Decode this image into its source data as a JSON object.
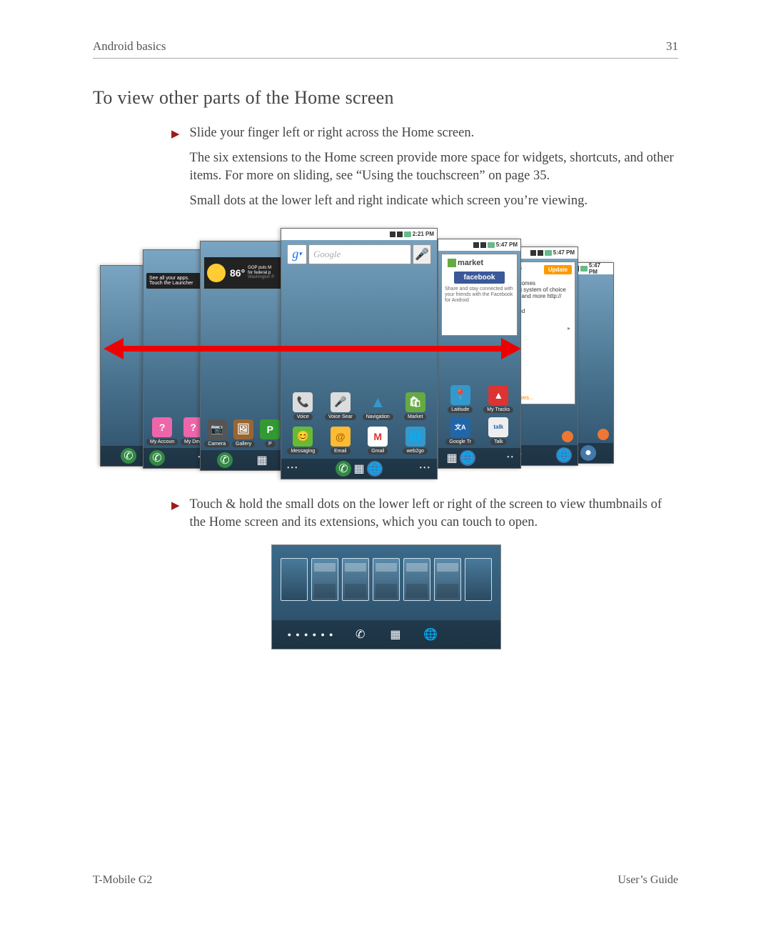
{
  "header": {
    "section": "Android basics",
    "page_number": "31"
  },
  "title": "To view other parts of the Home screen",
  "bullets": [
    {
      "lead": "Slide your finger left or right across the Home screen.",
      "paras": [
        "The six extensions to the Home screen provide more space for widgets, shortcuts, and other items. For more on sliding, see “Using the touchscreen” on page 35.",
        "Small dots at the lower left and right indicate which screen you’re viewing."
      ]
    },
    {
      "lead": "Touch & hold the small dots on the lower left or right of the screen to view thumbnails of the Home screen and its extensions, which you can touch to open.",
      "paras": []
    }
  ],
  "footer": {
    "left": "T-Mobile G2",
    "right": "User’s Guide"
  },
  "fig_large": {
    "status_times": {
      "center": "2:21 PM",
      "side": "5:47 PM"
    },
    "tip_text": "See all your apps. Touch the Launcher",
    "news": {
      "temp": "86°",
      "headline": "GOP puts M",
      "sub1": "for federal p",
      "sub2": "Washington P"
    },
    "search_placeholder": "Google",
    "market": {
      "title": "market",
      "fb": "facebook",
      "desc": "Share and stay connected with your friends with the Facebook for Android"
    },
    "update": {
      "btn": "Update",
      "line1": "g?",
      "line2": "ecomes",
      "line3": "ng system of choice",
      "line4": "ai and more http://",
      "line5": "eed",
      "bottom": "tuses..."
    },
    "apps_center_row1": [
      {
        "label": "Voice",
        "icon": "📞",
        "bg": "#ddd"
      },
      {
        "label": "Voice Sear",
        "icon": "🎤",
        "bg": "#ddd"
      },
      {
        "label": "Navigation",
        "icon": "▲",
        "bg": "#39c"
      },
      {
        "label": "Market",
        "icon": "🛍",
        "bg": "#6a4"
      }
    ],
    "apps_center_row2": [
      {
        "label": "Messaging",
        "icon": "💬",
        "bg": "#6b3"
      },
      {
        "label": "Email",
        "icon": "✉",
        "bg": "#fb3"
      },
      {
        "label": "Gmail",
        "icon": "M",
        "bg": "#d33"
      },
      {
        "label": "web2go",
        "icon": "🌐",
        "bg": "#39c"
      }
    ],
    "apps_panel2_row": [
      {
        "label": "My Accoun",
        "icon": "?",
        "bg": "#e6a"
      },
      {
        "label": "My Devi",
        "icon": "?",
        "bg": "#e6a"
      }
    ],
    "apps_panel3_row": [
      {
        "label": "Camera",
        "icon": "📷",
        "bg": "#555"
      },
      {
        "label": "Gallery",
        "icon": "🖼",
        "bg": "#963"
      },
      {
        "label": "P",
        "icon": "P",
        "bg": "#393"
      }
    ],
    "apps_panel5_row1": [
      {
        "label": "Latitude",
        "icon": "📍",
        "bg": "#39c"
      },
      {
        "label": "My Tracks",
        "icon": "▲",
        "bg": "#d33"
      }
    ],
    "apps_panel5_row2": [
      {
        "label": "Google Tr",
        "icon": "文A",
        "bg": "#26a"
      },
      {
        "label": "Talk",
        "icon": "talk",
        "bg": "#ddd"
      }
    ]
  },
  "fig_small": {
    "dots": "● ● ● ● ● ●"
  }
}
